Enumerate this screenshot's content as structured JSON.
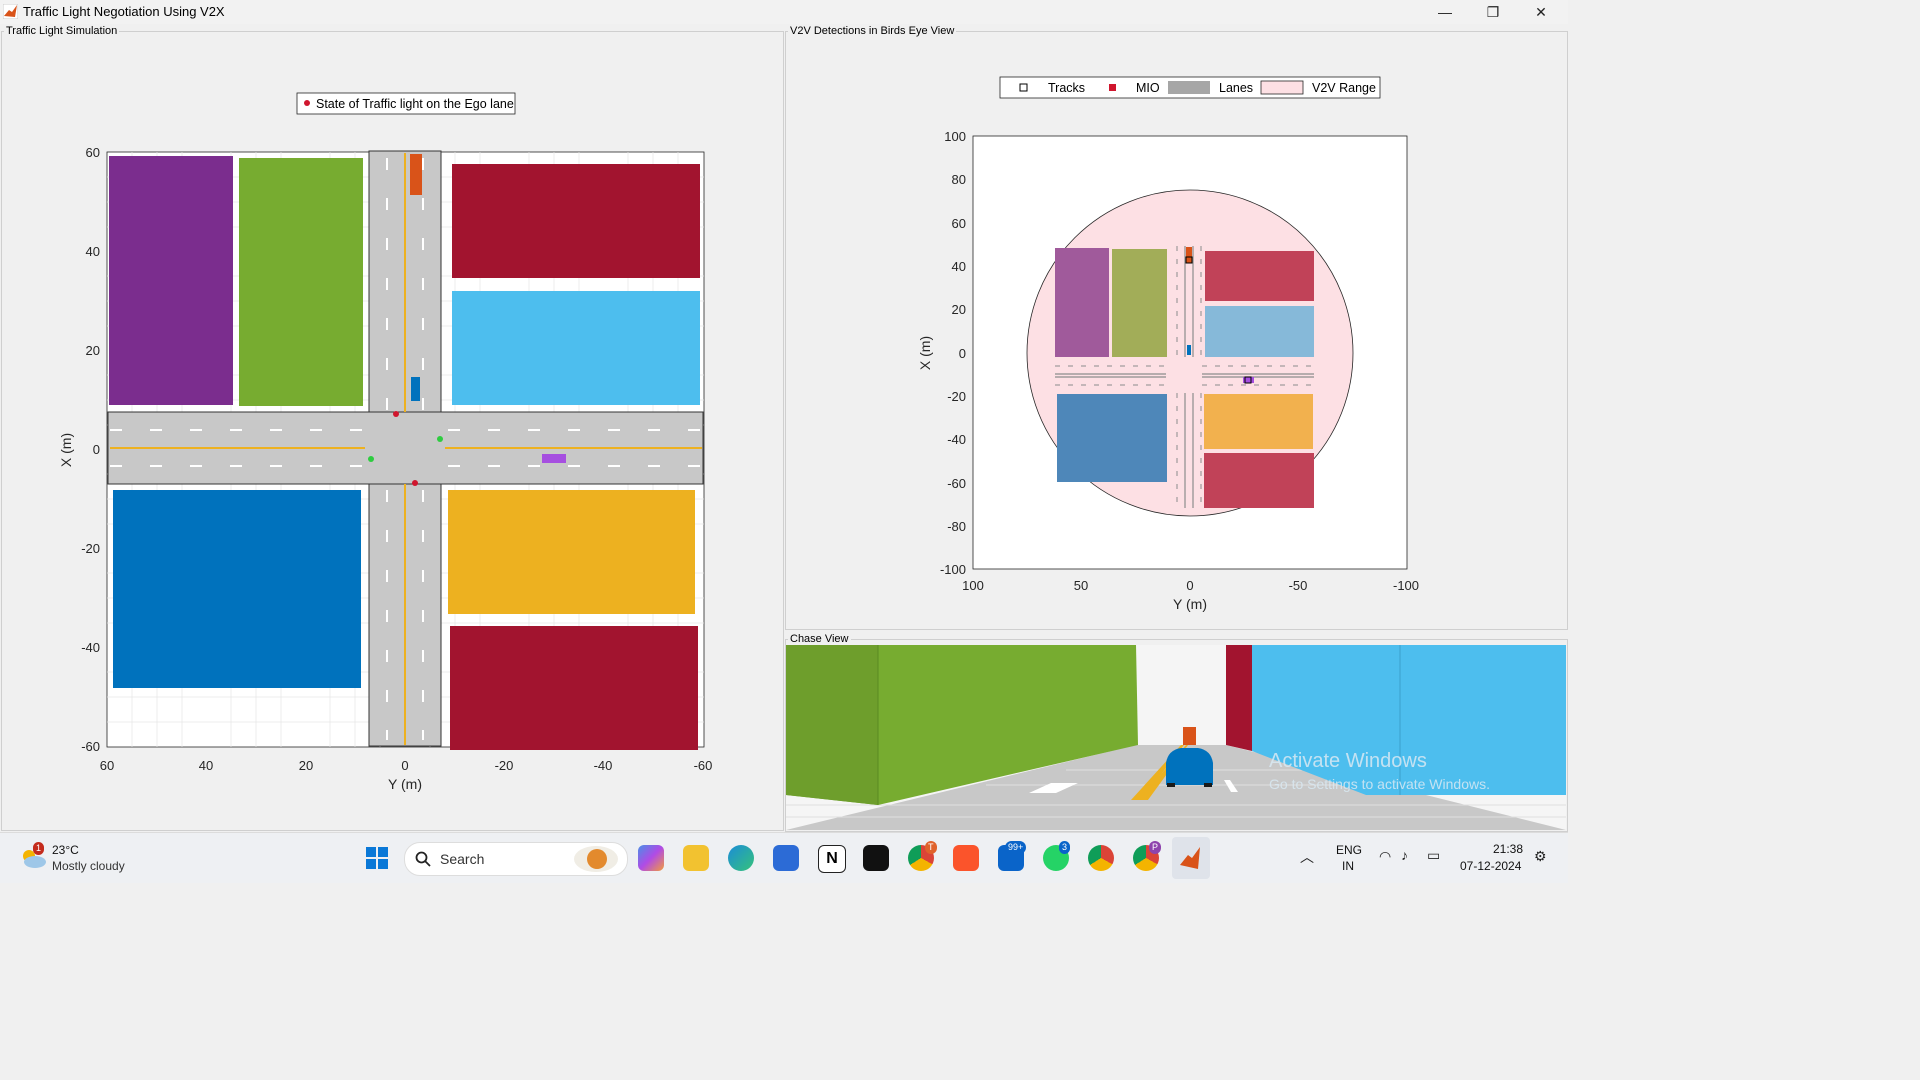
{
  "window": {
    "title": "Traffic Light Negotiation Using V2X",
    "minimize": "—",
    "restore": "❐",
    "close": "✕"
  },
  "panels": {
    "sim": "Traffic Light Simulation",
    "bev": "V2V Detections in Birds Eye View",
    "chase": "Chase View"
  },
  "sim_plot": {
    "legend": "State of Traffic light on the Ego lane",
    "xlabel": "Y (m)",
    "ylabel": "X (m)",
    "xticks": [
      "60",
      "40",
      "20",
      "0",
      "-20",
      "-40",
      "-60"
    ],
    "yticks": [
      "60",
      "40",
      "20",
      "0",
      "-20",
      "-40",
      "-60"
    ]
  },
  "bev_plot": {
    "legend": [
      "Tracks",
      "MIO",
      "Lanes",
      "V2V Range"
    ],
    "xlabel": "Y (m)",
    "ylabel": "X (m)",
    "xticks": [
      "100",
      "50",
      "0",
      "-50",
      "-100"
    ],
    "yticks": [
      "100",
      "80",
      "60",
      "40",
      "20",
      "0",
      "-20",
      "-40",
      "-60",
      "-80",
      "-100"
    ]
  },
  "chase": {
    "watermark1": "Activate Windows",
    "watermark2": "Go to Settings to activate Windows."
  },
  "taskbar": {
    "weather_badge": "1",
    "temp": "23°C",
    "condition": "Mostly cloudy",
    "search": "Search",
    "lang1": "ENG",
    "lang2": "IN",
    "time": "21:38",
    "date": "07-12-2024",
    "badge_outlook": "99+",
    "badge_whatsapp": "3",
    "badge_chrome1": "T",
    "badge_chrome2": "P"
  },
  "colors": {
    "purple": "#7b2d8e",
    "green": "#77ac30",
    "red": "#a2142f",
    "cyan": "#4dbeee",
    "blue": "#0072bd",
    "yellow": "#edb120",
    "orange": "#d95319",
    "road": "#c8c8c8"
  }
}
